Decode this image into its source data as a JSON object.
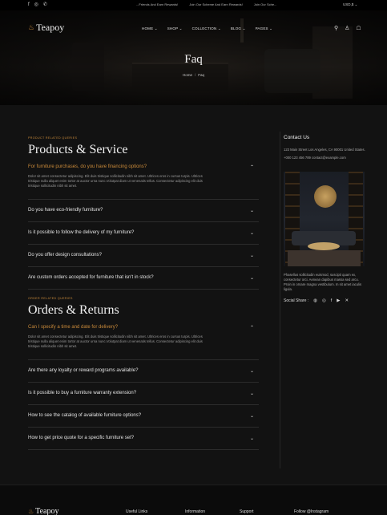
{
  "topbar": {
    "social": [
      "f",
      "◎",
      "✆"
    ],
    "ticker": [
      "...Friends And Earn Rewards!",
      "Join Our Scheme And Earn Rewards!",
      "Join Our Sche..."
    ],
    "currency": "USD,$ ⌄"
  },
  "brand": {
    "name": "Teapoy"
  },
  "nav": [
    "HOME ⌄",
    "SHOP ⌄",
    "COLLECTION ⌄",
    "BLOG ⌄",
    "PAGES ⌄"
  ],
  "hero": {
    "title": "Faq",
    "breadcrumb_home": "Home",
    "breadcrumb_current": "Faq"
  },
  "section1": {
    "eyebrow": "PRODUCT RELATED QUERIES",
    "title": "Products & Service",
    "faqs": [
      {
        "q": "For furniture purchases, do you have financing options?",
        "active": true,
        "a": "Dolor sit amet consectetur adipiscing. Elit duis tristique sollicitudin nibh sit amet. Ultrices eros in cursus turpis. Ultrices tristique nulla aliquet enim tortor at auctor urna nunc.Volutpat diam ut venenatis tellus. Consectetur adipiscing elit duis tristique sollicitudin nibh sit amet."
      },
      {
        "q": "Do you have eco-friendly furniture?"
      },
      {
        "q": "Is it possible to follow the delivery of my furniture?"
      },
      {
        "q": "Do you offer design consultations?"
      },
      {
        "q": "Are custom orders accepted for furniture that isn't in stock?"
      }
    ]
  },
  "section2": {
    "eyebrow": "ORDER RELATED QUERIES",
    "title": "Orders & Returns",
    "faqs": [
      {
        "q": "Can I specify a time and date for delivery?",
        "active": true,
        "a": "Dolor sit amet consectetur adipiscing. Elit duis tristique sollicitudin nibh sit amet. Ultrices eros in cursus turpis. Ultrices tristique nulla aliquet enim tortor at auctor urna nunc.Volutpat diam ut venenatis tellus. Consectetur adipiscing elit duis tristique sollicitudin nibh sit amet."
      },
      {
        "q": "Are there any loyalty or reward programs available?"
      },
      {
        "q": "Is it possible to buy a furniture warranty extension?"
      },
      {
        "q": "How to see the catalog of available furniture options?"
      },
      {
        "q": "How to get price quote for a specific furniture set?"
      }
    ]
  },
  "sidebar": {
    "title": "Contact Us",
    "address": "123 Main Street Los Angeles, CA 90001 United States.",
    "contact": "+000 123 456 789   contact@example.com",
    "desc": "Phasellus sollicitudin euismod, suscipit quam ex, consectetur orci. Aenean dapibus massa sed arcu. Proin in ornare magna vestibulum. In sit amet iaculis ligula.",
    "share_label": "Social Share :",
    "share_icons": [
      "◍",
      "◎",
      "f",
      "▶",
      "✕"
    ]
  },
  "footer": {
    "cols": [
      "Useful Links",
      "Information",
      "Support",
      "Follow @Instagram"
    ]
  },
  "colors": {
    "accent": "#c98a3a",
    "bg": "#121212"
  }
}
